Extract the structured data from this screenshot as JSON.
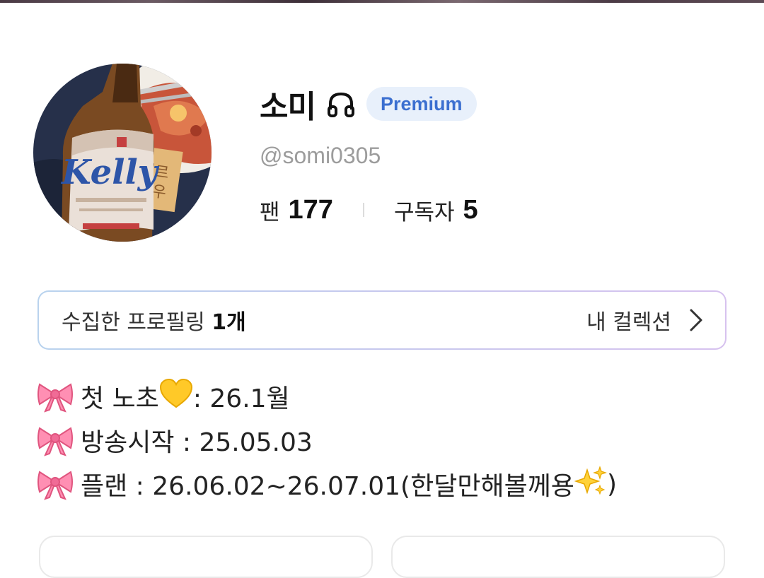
{
  "profile": {
    "display_name": "소미",
    "name_icon": "headphones-icon",
    "badge": "Premium",
    "handle": "@somi0305",
    "avatar_icon": "profile-photo",
    "stats": {
      "fans_label": "팬",
      "fans_value": "177",
      "subscribers_label": "구독자",
      "subscribers_value": "5"
    }
  },
  "collection": {
    "label": "수집한 프로필링",
    "count": "1개",
    "link_label": "내 컬렉션",
    "link_icon": "chevron-right-icon"
  },
  "bio": {
    "lines": [
      {
        "icon": "ribbon-icon",
        "prefix": "첫 노초",
        "emoji": "yellow-heart-icon",
        "suffix": " : 26.1월"
      },
      {
        "icon": "ribbon-icon",
        "text": "방송시작 : 25.05.03"
      },
      {
        "icon": "ribbon-icon",
        "text": "플랜 : 26.06.02~26.07.01(한달만해볼께용",
        "emoji": "sparkles-icon",
        "suffix": ")"
      }
    ]
  },
  "colors": {
    "badge_bg": "#e8f0fb",
    "badge_text": "#3b6fd0",
    "handle_text": "#9c9c9c",
    "card_border_start": "#b9d3ee",
    "card_border_end": "#d7c2ef",
    "ribbon": "#ff8fb3"
  }
}
